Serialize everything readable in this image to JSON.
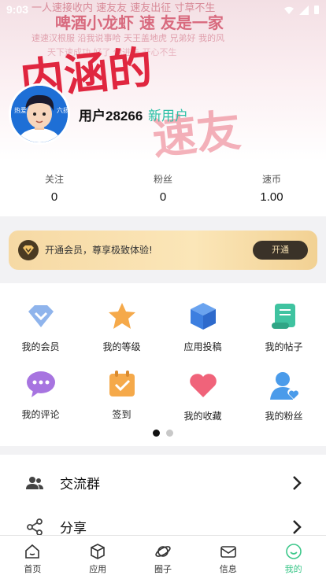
{
  "status": {
    "time": "9:03"
  },
  "banner": {
    "bg_lines": [
      "一人速接收内 速友友 速友出征 寸草不生",
      "啤酒小龙虾 速 友是一家",
      "速速汉根服 沿我说事哈 天王盖地虎 兄弟好 我的风",
      "内涵的 速友"
    ],
    "headline": "内涵的",
    "headline2": "速友"
  },
  "user": {
    "name": "用户28266",
    "tag": "新用户",
    "avatar_left": "热爱",
    "avatar_right": "六扬"
  },
  "stats": [
    {
      "label": "关注",
      "value": "0"
    },
    {
      "label": "粉丝",
      "value": "0"
    },
    {
      "label": "速币",
      "value": "1.00"
    }
  ],
  "vip": {
    "text": "开通会员，尊享极致体验!",
    "button": "开通"
  },
  "grid": [
    {
      "label": "我的会员",
      "icon": "diamond-icon"
    },
    {
      "label": "我的等级",
      "icon": "star-icon"
    },
    {
      "label": "应用投稿",
      "icon": "cube-icon"
    },
    {
      "label": "我的帖子",
      "icon": "scroll-icon"
    },
    {
      "label": "我的评论",
      "icon": "chat-bubble-icon"
    },
    {
      "label": "签到",
      "icon": "calendar-check-icon"
    },
    {
      "label": "我的收藏",
      "icon": "heart-icon"
    },
    {
      "label": "我的粉丝",
      "icon": "user-heart-icon"
    }
  ],
  "list": [
    {
      "label": "交流群",
      "icon": "group-icon"
    },
    {
      "label": "分享",
      "icon": "share-icon"
    }
  ],
  "tabs": [
    {
      "label": "首页",
      "icon": "home-icon"
    },
    {
      "label": "应用",
      "icon": "box-icon"
    },
    {
      "label": "圈子",
      "icon": "planet-icon"
    },
    {
      "label": "信息",
      "icon": "mail-icon"
    },
    {
      "label": "我的",
      "icon": "smile-icon",
      "active": true
    }
  ],
  "colors": {
    "accent": "#3cc78a",
    "tag": "#2bc0a6",
    "headline": "#e0263f"
  }
}
